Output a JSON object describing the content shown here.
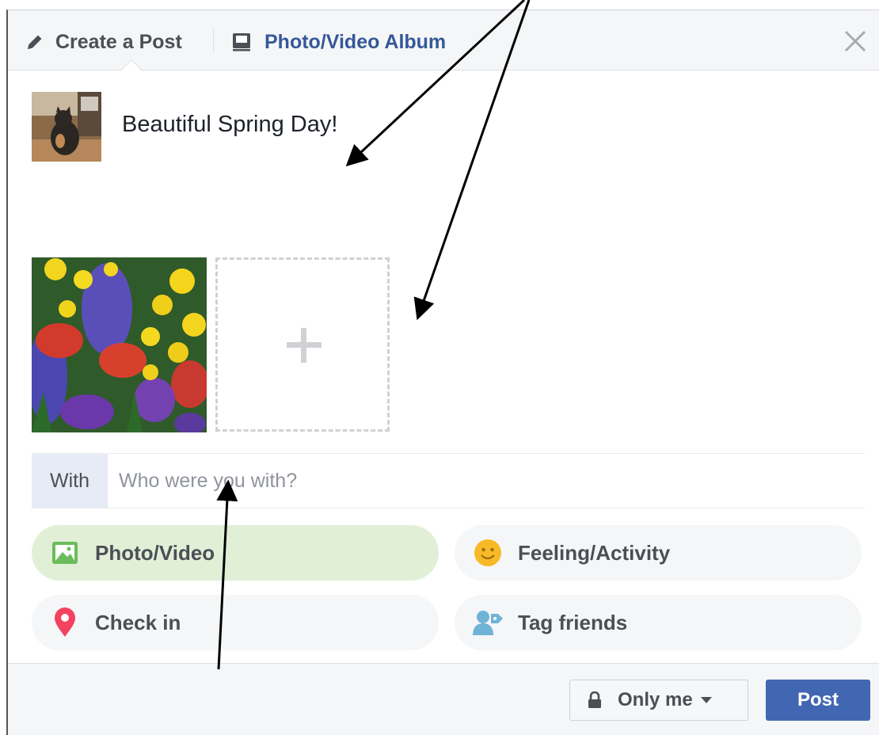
{
  "header": {
    "create_tab_label": "Create a Post",
    "album_tab_label": "Photo/Video Album",
    "colors": {
      "album_link": "#365899",
      "header_bg": "#f5f6f7"
    }
  },
  "composer": {
    "post_text": "Beautiful Spring Day!"
  },
  "tagging": {
    "with_label": "With",
    "with_placeholder": "Who were you with?"
  },
  "options": [
    {
      "label": "Photo/Video",
      "icon": "photo-icon",
      "active": true
    },
    {
      "label": "Feeling/Activity",
      "icon": "smiley-icon"
    },
    {
      "label": "Check in",
      "icon": "location-pin-icon"
    },
    {
      "label": "Tag friends",
      "icon": "tag-friends-icon"
    }
  ],
  "footer": {
    "privacy_label": "Only me",
    "post_label": "Post",
    "colors": {
      "post_button": "#4267b2"
    }
  },
  "icons": [
    "pencil-icon",
    "album-icon",
    "close-icon",
    "plus-icon",
    "lock-icon",
    "caret-down-icon"
  ]
}
